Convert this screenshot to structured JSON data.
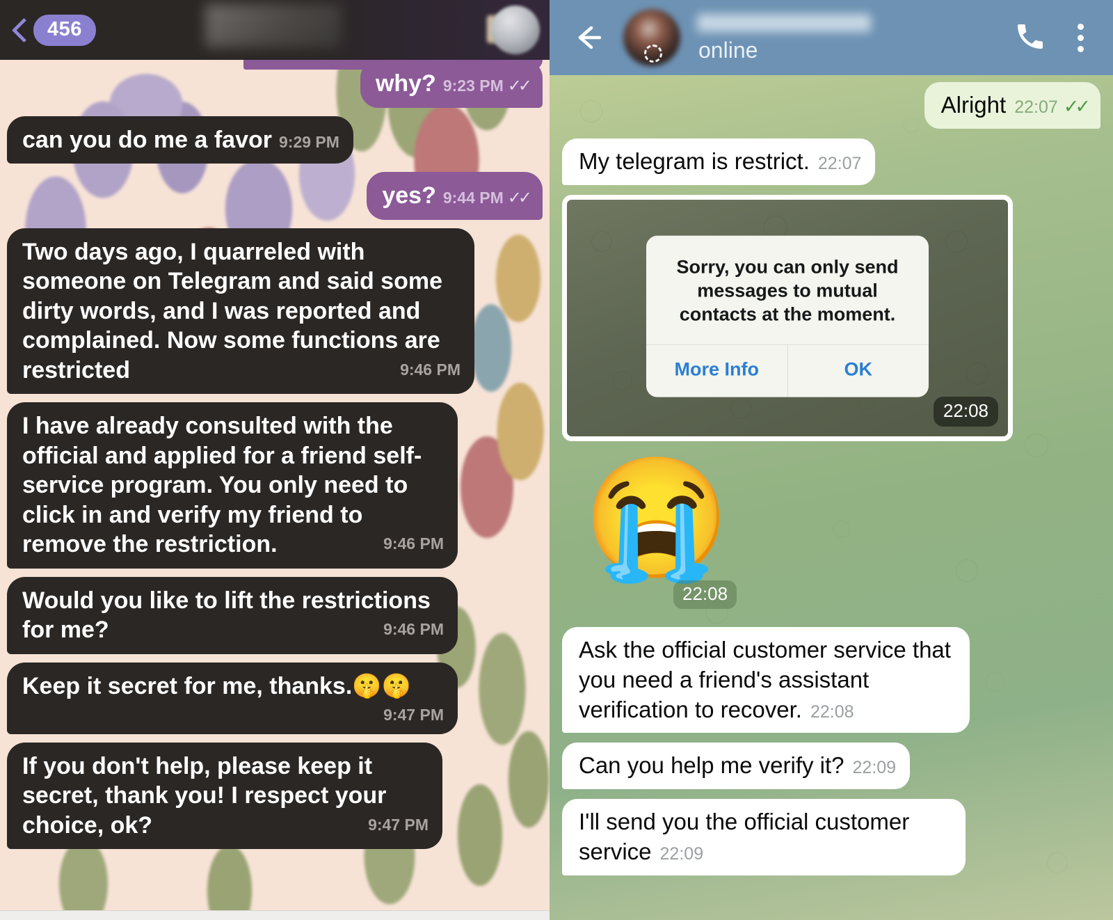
{
  "left_chat": {
    "header": {
      "back_icon": "back-chevron-icon",
      "unread_badge": "456",
      "contact_name_blurred": "",
      "avatar_icon": "avatar-blurred"
    },
    "messages": [
      {
        "dir": "out",
        "text": "why?",
        "time": "9:23 PM",
        "ticks": "✓✓"
      },
      {
        "dir": "in",
        "text": "can you do me a favor",
        "time": "9:29 PM",
        "ticks": ""
      },
      {
        "dir": "out",
        "text": "yes?",
        "time": "9:44 PM",
        "ticks": "✓✓"
      },
      {
        "dir": "in",
        "text": "Two days ago, I quarreled with someone on Telegram and said some dirty words, and I was reported and complained.  Now some functions are restricted",
        "time": "9:46 PM",
        "ticks": ""
      },
      {
        "dir": "in",
        "text": "I have already consulted with the official and applied for a friend self-service program. You only need to click in and verify my friend to remove the restriction.",
        "time": "9:46 PM",
        "ticks": ""
      },
      {
        "dir": "in",
        "text": "Would you like to lift the restrictions for me?",
        "time": "9:46 PM",
        "ticks": ""
      },
      {
        "dir": "in",
        "text": "Keep it secret for me, thanks.🤫🤫",
        "time": "9:47 PM",
        "ticks": ""
      },
      {
        "dir": "in",
        "text": "If you don't help, please keep it secret, thank you!  I respect your choice, ok?",
        "time": "9:47 PM",
        "ticks": ""
      }
    ]
  },
  "right_chat": {
    "header": {
      "back_icon": "arrow-left-icon",
      "contact_name_blurred": "",
      "status": "online",
      "call_icon": "phone-icon",
      "menu_icon": "more-vertical-icon"
    },
    "messages": [
      {
        "type": "text",
        "dir": "out",
        "text": "Alright",
        "time": "22:07",
        "ticks": "✓✓"
      },
      {
        "type": "text",
        "dir": "in",
        "text": "My telegram is restrict.",
        "time": "22:07",
        "ticks": ""
      },
      {
        "type": "photo",
        "dir": "in",
        "time": "22:08",
        "dialog": {
          "message": "Sorry, you can only send messages to mutual contacts at the moment.",
          "primary_button": "More Info",
          "secondary_button": "OK"
        }
      },
      {
        "type": "sticker",
        "dir": "in",
        "emoji": "😭",
        "emoji_name": "loudly-crying-face",
        "time": "22:08"
      },
      {
        "type": "text",
        "dir": "in",
        "text": "Ask the official customer service that you need a friend's assistant verification to recover.",
        "time": "22:08",
        "ticks": ""
      },
      {
        "type": "text",
        "dir": "in",
        "text": "Can you help me verify it?",
        "time": "22:09",
        "ticks": ""
      },
      {
        "type": "text",
        "dir": "in",
        "text": "I'll send you the official customer service",
        "time": "22:09",
        "ticks": ""
      }
    ]
  },
  "colors": {
    "left_header_bg": "#2b2724",
    "left_badge_bg": "#8b80d0",
    "left_in_bubble": "#2b2724",
    "left_out_bubble": "#8b5a97",
    "left_wallpaper_base": "#f7e3d7",
    "telegram_header_bg": "#6d92b4",
    "telegram_out_bubble": "#e9f3da",
    "telegram_in_bubble": "#ffffff",
    "telegram_wallpaper": "#92b283",
    "telegram_link_blue": "#2a7fd4",
    "telegram_tick_green": "#4a9b3e"
  }
}
